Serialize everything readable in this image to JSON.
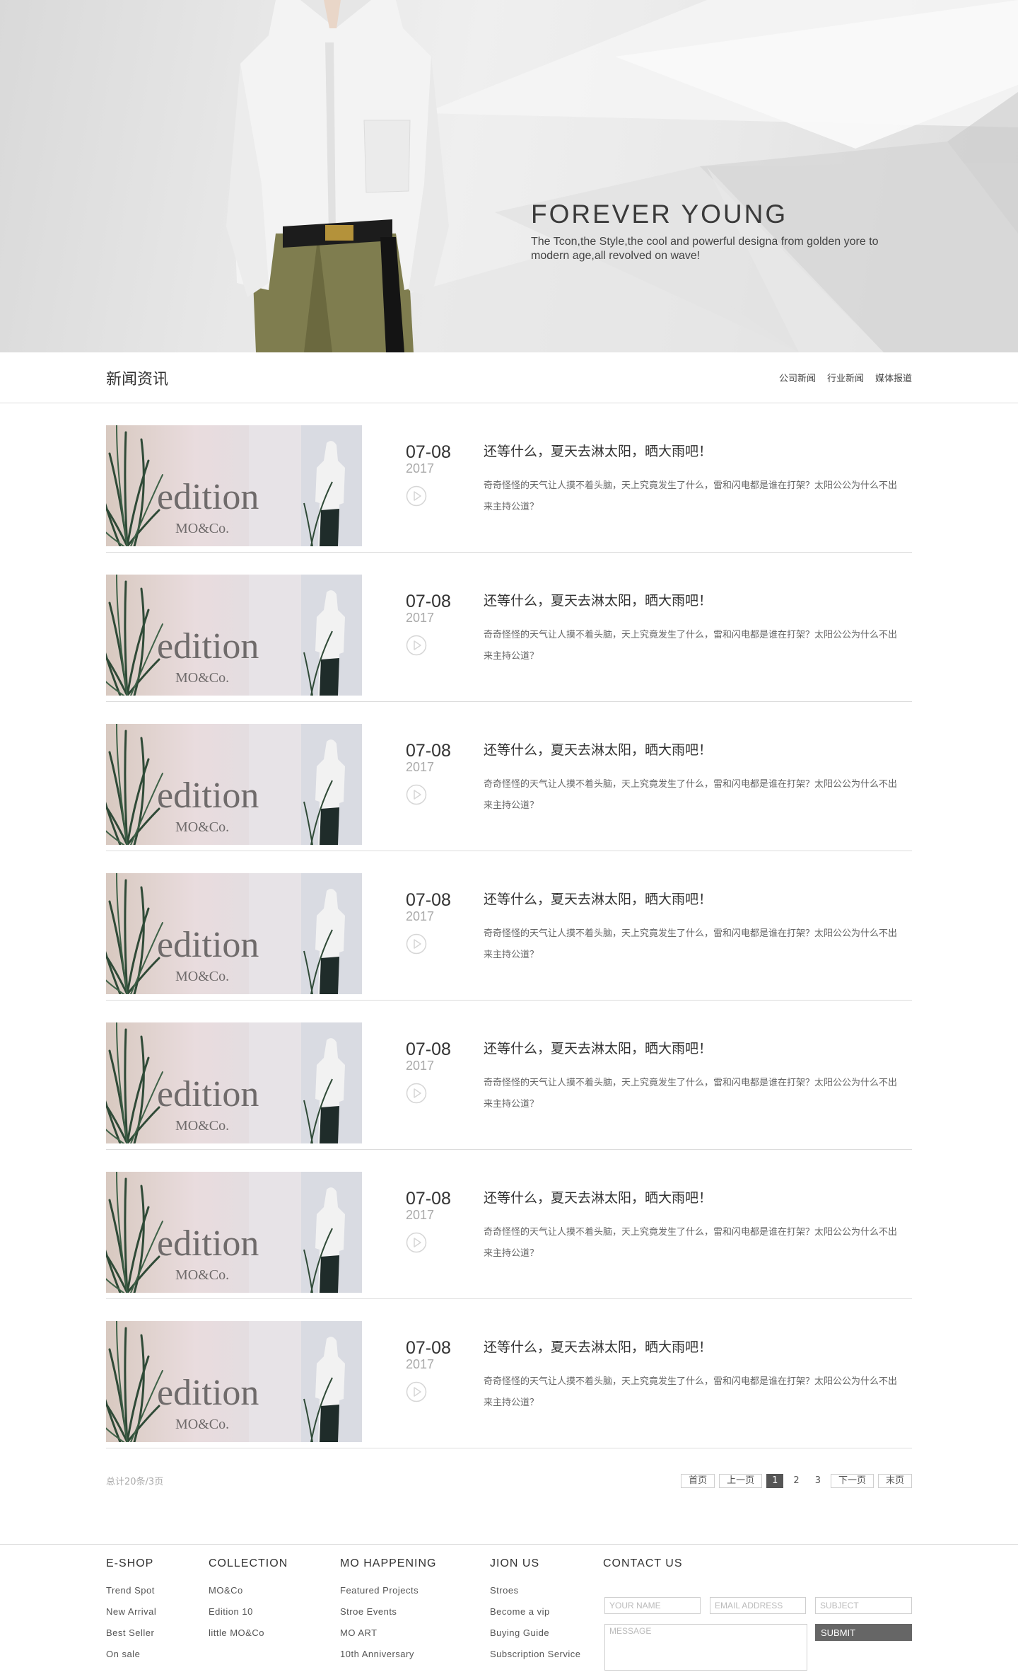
{
  "hero": {
    "title": "FOREVER YOUNG",
    "description": "The Tcon,the Style,the cool and powerful designa from golden yore to modern age,all revolved on wave!"
  },
  "section": {
    "title": "新闻资讯",
    "categories": [
      "公司新闻",
      "行业新闻",
      "媒体报道"
    ]
  },
  "news": {
    "thumb_text": {
      "main": "edition",
      "sub": "MO&Co."
    },
    "items": [
      {
        "date": "07-08",
        "year": "2017",
        "title": "还等什么，夏天去淋太阳，晒大雨吧！",
        "excerpt": "奇奇怪怪的天气让人摸不着头脑，天上究竟发生了什么，雷和闪电都是谁在打架？太阳公公为什么不出来主持公道？"
      },
      {
        "date": "07-08",
        "year": "2017",
        "title": "还等什么，夏天去淋太阳，晒大雨吧！",
        "excerpt": "奇奇怪怪的天气让人摸不着头脑，天上究竟发生了什么，雷和闪电都是谁在打架？太阳公公为什么不出来主持公道？"
      },
      {
        "date": "07-08",
        "year": "2017",
        "title": "还等什么，夏天去淋太阳，晒大雨吧！",
        "excerpt": "奇奇怪怪的天气让人摸不着头脑，天上究竟发生了什么，雷和闪电都是谁在打架？太阳公公为什么不出来主持公道？"
      },
      {
        "date": "07-08",
        "year": "2017",
        "title": "还等什么，夏天去淋太阳，晒大雨吧！",
        "excerpt": "奇奇怪怪的天气让人摸不着头脑，天上究竟发生了什么，雷和闪电都是谁在打架？太阳公公为什么不出来主持公道？"
      },
      {
        "date": "07-08",
        "year": "2017",
        "title": "还等什么，夏天去淋太阳，晒大雨吧！",
        "excerpt": "奇奇怪怪的天气让人摸不着头脑，天上究竟发生了什么，雷和闪电都是谁在打架？太阳公公为什么不出来主持公道？"
      },
      {
        "date": "07-08",
        "year": "2017",
        "title": "还等什么，夏天去淋太阳，晒大雨吧！",
        "excerpt": "奇奇怪怪的天气让人摸不着头脑，天上究竟发生了什么，雷和闪电都是谁在打架？太阳公公为什么不出来主持公道？"
      },
      {
        "date": "07-08",
        "year": "2017",
        "title": "还等什么，夏天去淋太阳，晒大雨吧！",
        "excerpt": "奇奇怪怪的天气让人摸不着头脑，天上究竟发生了什么，雷和闪电都是谁在打架？太阳公公为什么不出来主持公道？"
      }
    ]
  },
  "pagination": {
    "total": "总计20条/3页",
    "first": "首页",
    "prev": "上一页",
    "pages": [
      "1",
      "2",
      "3"
    ],
    "current_page": "1",
    "next": "下一页",
    "last": "末页"
  },
  "footer": {
    "columns": [
      {
        "title": "E-SHOP",
        "links": [
          "Trend Spot",
          "New Arrival",
          "Best Seller",
          "On sale"
        ]
      },
      {
        "title": "COLLECTION",
        "links": [
          "MO&Co",
          "Edition 10",
          "little MO&Co"
        ]
      },
      {
        "title": "MO HAPPENING",
        "links": [
          "Featured Projects",
          "Stroe Events",
          "MO ART",
          "10th Anniversary"
        ]
      },
      {
        "title": "JION US",
        "links": [
          "Stroes",
          "Become a vip",
          "Buying Guide",
          "Subscription Service"
        ]
      }
    ],
    "contact": {
      "title": "CONTACT US",
      "name_placeholder": "YOUR NAME",
      "email_placeholder": "EMAIL ADDRESS",
      "subject_placeholder": "SUBJECT",
      "message_placeholder": "MESSAGE",
      "submit_label": "SUBMIT"
    }
  }
}
